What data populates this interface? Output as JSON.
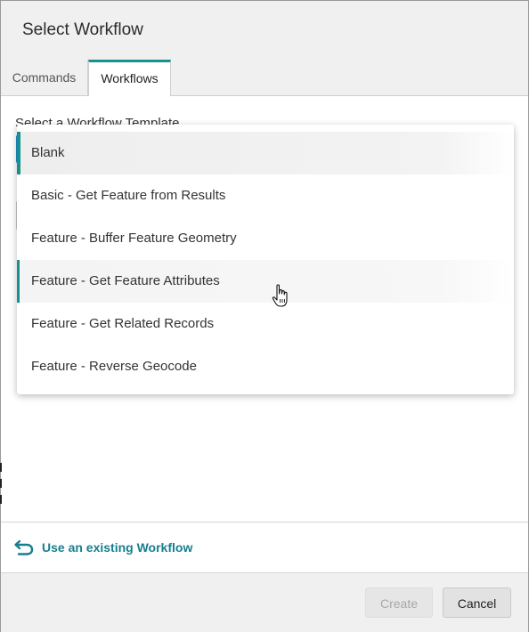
{
  "dialog": {
    "title": "Select Workflow"
  },
  "tabs": [
    {
      "label": "Commands",
      "active": false
    },
    {
      "label": "Workflows",
      "active": true
    }
  ],
  "form": {
    "template_label": "Select a Workflow Template"
  },
  "dropdown": {
    "options": [
      {
        "label": "Blank",
        "state": "selected"
      },
      {
        "label": "Basic - Get Feature from Results",
        "state": "normal"
      },
      {
        "label": "Feature - Buffer Feature Geometry",
        "state": "normal"
      },
      {
        "label": "Feature - Get Feature Attributes",
        "state": "hover"
      },
      {
        "label": "Feature - Get Related Records",
        "state": "normal"
      },
      {
        "label": "Feature - Reverse Geocode",
        "state": "normal"
      }
    ]
  },
  "existing": {
    "label": "Use an existing Workflow",
    "icon": "return-arrow-icon"
  },
  "footer": {
    "create_label": "Create",
    "cancel_label": "Cancel"
  },
  "colors": {
    "accent": "#18908f",
    "link": "#167f8e",
    "focus_border": "#1a8ecb"
  }
}
